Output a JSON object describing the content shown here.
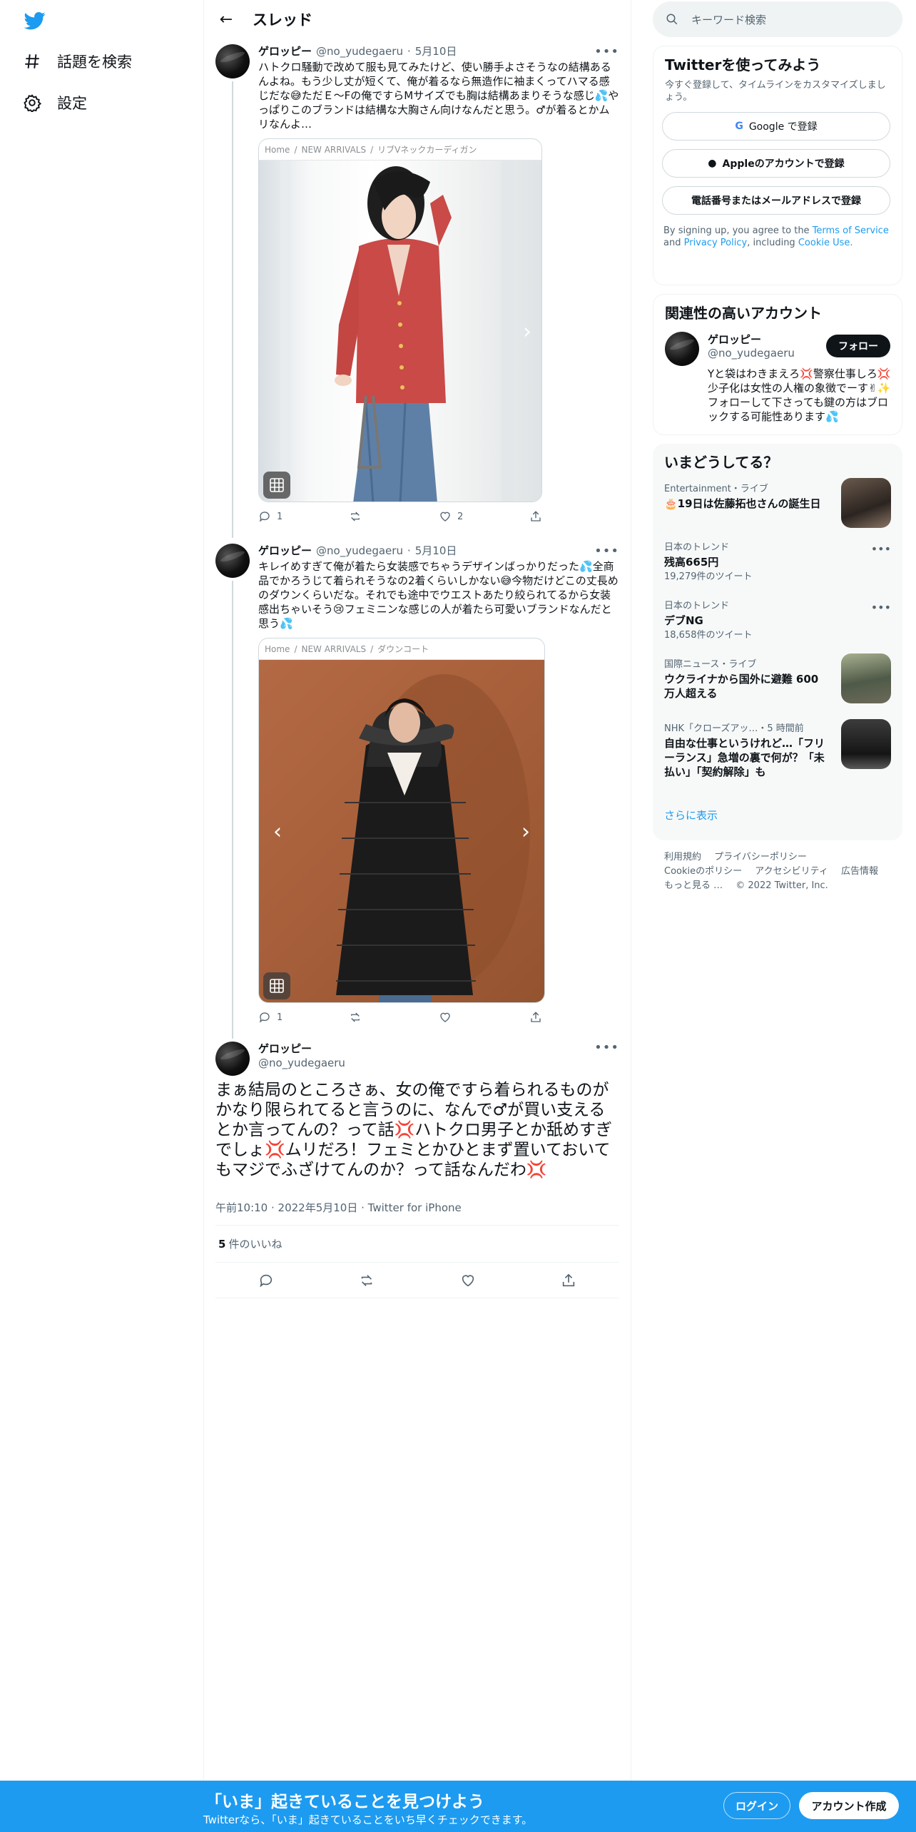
{
  "nav": {
    "items": [
      {
        "label": "話題を検索",
        "icon": "hashtag-icon"
      },
      {
        "label": "設定",
        "icon": "gear-icon"
      }
    ]
  },
  "header": {
    "title": "スレッド"
  },
  "tweets": [
    {
      "name": "ゲロッピー",
      "handle": "@no_yudegaeru",
      "date": "5月10日",
      "text": "ハトクロ騒動で改めて服も見てみたけど、使い勝手よさそうなの結構あるんよね。もう少し丈が短くて、俺が着るなら無造作に袖まくってハマる感じだな😅ただＥ〜Fの俺ですらMサイズでも胸は結構あまりそうな感じ💦やっぱりこのブランドは結構な大胸さん向けなんだと思う。♂が着るとかムリなんよ…",
      "card_breadcrumb": [
        "Home",
        "NEW ARRIVALS",
        "リブVネックカーディガン"
      ],
      "replies": "1",
      "retweets": "",
      "likes": "2"
    },
    {
      "name": "ゲロッピー",
      "handle": "@no_yudegaeru",
      "date": "5月10日",
      "text": "キレイめすぎて俺が着たら女装感でちゃうデザインばっかりだった💦全商品でかろうじて着られそうなの2着くらいしかない😅今物だけどこの丈長めのダウンくらいだな。それでも途中でウエストあたり絞られてるから女装感出ちゃいそう😢フェミニンな感じの人が着たら可愛いブランドなんだと思う💦",
      "card_breadcrumb": [
        "Home",
        "NEW ARRIVALS",
        "ダウンコート"
      ],
      "replies": "1",
      "retweets": "",
      "likes": ""
    }
  ],
  "main_tweet": {
    "name": "ゲロッピー",
    "handle": "@no_yudegaeru",
    "text": "まぁ結局のところさぁ、女の俺ですら着られるものがかなり限られてると言うのに、なんで♂が買い支えるとか言ってんの？って話💢ハトクロ男子とか舐めすぎでしょ💢ムリだろ！フェミとかひとまず置いておいてもマジでふざけてんのか？って話なんだわ💢",
    "time": "午前10:10",
    "date": "2022年5月10日",
    "client": "Twitter for iPhone",
    "likes_count": "5",
    "likes_label": "件のいいね"
  },
  "right": {
    "search_placeholder": "キーワード検索",
    "signup": {
      "title": "Twitterを使ってみよう",
      "subtitle": "今すぐ登録して、タイムラインをカスタマイズしましょう。",
      "google": "Google で登録",
      "apple": "Appleのアカウントで登録",
      "phone": "電話番号またはメールアドレスで登録",
      "terms_prefix": "By signing up, you agree to the",
      "terms_link": "Terms of Service",
      "terms_and": "and",
      "privacy_link": "Privacy Policy",
      "terms_including": ", including",
      "cookie_link": "Cookie Use."
    },
    "related": {
      "title": "関連性の高いアカウント",
      "name": "ゲロッピー",
      "handle": "@no_yudegaeru",
      "follow": "フォロー",
      "bio": "Yと袋はわきまえろ💢警察仕事しろ💢少子化は女性の人権の象徴でーす✌✨フォローして下さっても鍵の方はブロックする可能性あります💦"
    },
    "trends": {
      "title": "いまどうしてる？",
      "items": [
        {
          "meta": "Entertainment・ライブ",
          "title": "🎂19日は佐藤拓也さんの誕生日",
          "count": "",
          "thumb": true
        },
        {
          "meta": "日本のトレンド",
          "title": "残高665円",
          "count": "19,279件のツイート",
          "thumb": false
        },
        {
          "meta": "日本のトレンド",
          "title": "デブNG",
          "count": "18,658件のツイート",
          "thumb": false
        },
        {
          "meta": "国際ニュース・ライブ",
          "title": "ウクライナから国外に避難 600万人超える",
          "count": "",
          "thumb": true
        },
        {
          "meta": "NHK「クローズアッ…・5 時間前",
          "title": "自由な仕事というけれど…「フリーランス」急増の裏で何が？「未払い」「契約解除」も",
          "count": "",
          "thumb": true
        }
      ],
      "show_more": "さらに表示"
    },
    "footer": {
      "links": [
        "利用規約",
        "プライバシーポリシー",
        "Cookieのポリシー",
        "アクセシビリティ",
        "広告情報",
        "もっと見る …"
      ],
      "copyright": "© 2022 Twitter, Inc."
    }
  },
  "bottom_bar": {
    "title": "「いま」起きていることを見つけよう",
    "subtitle": "Twitterなら、「いま」起きていることをいち早くチェックできます。",
    "login": "ログイン",
    "signup": "アカウント作成"
  },
  "colors": {
    "accent": "#1d9bf0",
    "text": "#0f1419",
    "muted": "#536471"
  }
}
